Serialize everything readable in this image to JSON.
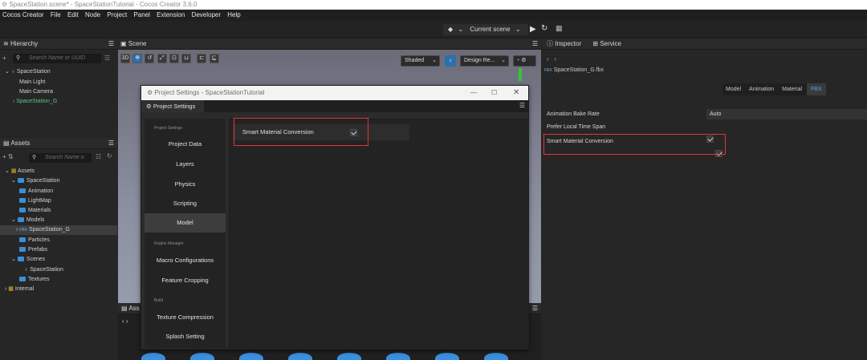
{
  "window": {
    "title": "SpaceStation.scene* - SpaceStationTutorial - Cocos Creator 3.6.0"
  },
  "menu": [
    "Cocos Creator",
    "File",
    "Edit",
    "Node",
    "Project",
    "Panel",
    "Extension",
    "Developer",
    "Help"
  ],
  "toolbar": {
    "scene_select": "Current scene"
  },
  "hierarchy": {
    "tab": "Hierarchy",
    "search_placeholder": "Search Name or UUID",
    "nodes": [
      "SpaceStation",
      "Main Light",
      "Main Camera",
      "SpaceStation_G"
    ]
  },
  "assets": {
    "tab": "Assets",
    "search_placeholder": "Search Name o",
    "tree": [
      "Assets",
      "SpaceStation",
      "Animation",
      "LightMap",
      "Materials",
      "Models",
      "SpaceStation_G",
      "Particles",
      "Prefabs",
      "Scenes",
      "SpaceStation",
      "Textures",
      "Internal"
    ]
  },
  "scene": {
    "tab": "Scene",
    "mode_3d": "3D",
    "shading": "Shaded",
    "design_res": "Design Re...",
    "bottom_tab": "Ass"
  },
  "dialog": {
    "title": "Project Settings - SpaceStationTutorial",
    "tab": "Project Settings",
    "section_project": "Project Settings",
    "section_engine": "Engine Manager",
    "section_build": "Build",
    "nav": [
      "Project Data",
      "Layers",
      "Physics",
      "Scripting",
      "Model",
      "Macro Configurations",
      "Feature Cropping",
      "Texture Compression",
      "Splash Setting"
    ],
    "selected": "Model",
    "option_label": "Smart Material Conversion",
    "option_checked": true
  },
  "inspector": {
    "tabs": [
      "Inspector",
      "Service"
    ],
    "file": "SpaceStation_G.fbx",
    "file_badge": "FBX",
    "subtabs": [
      "Model",
      "Animation",
      "Material",
      "FBX"
    ],
    "active_subtab": "FBX",
    "props": {
      "bake_rate_label": "Animation Bake Rate",
      "bake_rate_value": "Auto",
      "local_time_label": "Prefer Local Time Span",
      "smart_label": "Smart Material Conversion"
    }
  },
  "colors": {
    "highlight": "#e23535",
    "accent": "#3b8fd6",
    "selected_bg": "#3d3d3d"
  }
}
